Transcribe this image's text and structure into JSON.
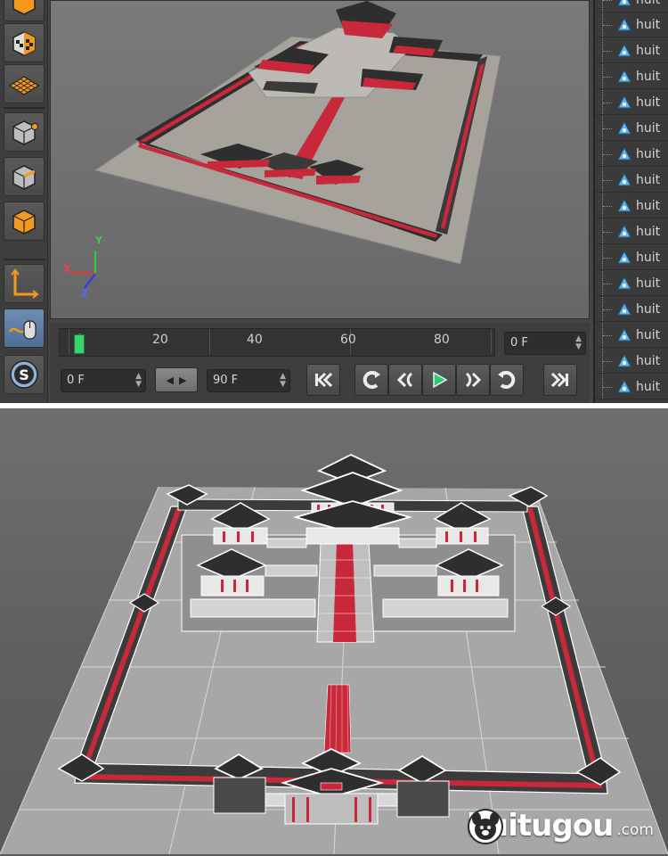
{
  "toolbar": {
    "tools": [
      {
        "name": "model-mode-icon"
      },
      {
        "name": "texture-mode-icon"
      },
      {
        "name": "workplane-icon"
      },
      {
        "name": "points-mode-icon"
      },
      {
        "name": "edges-mode-icon"
      },
      {
        "name": "polygons-mode-icon"
      },
      {
        "name": "axis-mode-icon"
      },
      {
        "name": "tweak-mode-icon"
      },
      {
        "name": "snap-icon"
      }
    ]
  },
  "viewport": {
    "axes": {
      "x": "X",
      "y": "Y",
      "z": "Z"
    }
  },
  "timeline": {
    "ticks": [
      "0",
      "20",
      "40",
      "60",
      "80"
    ],
    "current_frame": "0 F",
    "start_frame": "0 F",
    "end_frame": "90 F",
    "playhead_frame": 0
  },
  "transport": {
    "buttons": [
      {
        "name": "goto-start-button",
        "icon": "skip-to-start-icon"
      },
      {
        "name": "prev-key-button",
        "icon": "previous-key-icon"
      },
      {
        "name": "step-back-button",
        "icon": "step-back-icon"
      },
      {
        "name": "play-button",
        "icon": "play-icon"
      },
      {
        "name": "step-forward-button",
        "icon": "step-forward-icon"
      },
      {
        "name": "next-key-button",
        "icon": "next-key-icon"
      },
      {
        "name": "goto-end-button",
        "icon": "skip-to-end-icon"
      }
    ]
  },
  "object_manager": {
    "items": [
      "huit",
      "huit",
      "huit",
      "huit",
      "huit",
      "huit",
      "huit",
      "huit",
      "huit",
      "huit",
      "huit",
      "huit",
      "huit",
      "huit",
      "huit",
      "huit"
    ]
  },
  "watermark": {
    "text": "huitugou",
    "suffix": ".com"
  },
  "colors": {
    "accent_red": "#c8283a",
    "playhead_green": "#3ad36b",
    "play_green": "#2ecc71",
    "toolbar_orange": "#f19a1e"
  }
}
